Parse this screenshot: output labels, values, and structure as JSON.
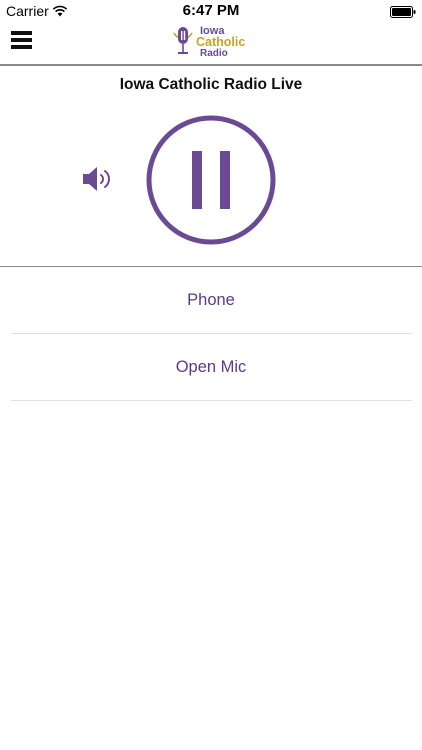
{
  "status_bar": {
    "carrier": "Carrier",
    "time": "6:47 PM"
  },
  "nav": {
    "logo_line1": "Iowa",
    "logo_line2": "Catholic",
    "logo_line3": "Radio"
  },
  "player": {
    "title": "Iowa Catholic Radio Live",
    "state": "playing"
  },
  "menu_items": [
    {
      "label": "Phone"
    },
    {
      "label": "Open Mic"
    }
  ],
  "colors": {
    "accent": "#6b4a94",
    "logo_gold": "#c9a227",
    "text": "#111111",
    "divider": "#8a8a8a"
  },
  "icons": [
    "wifi-icon",
    "battery-icon",
    "hamburger-menu-icon",
    "volume-icon",
    "pause-icon",
    "microphone-icon"
  ]
}
